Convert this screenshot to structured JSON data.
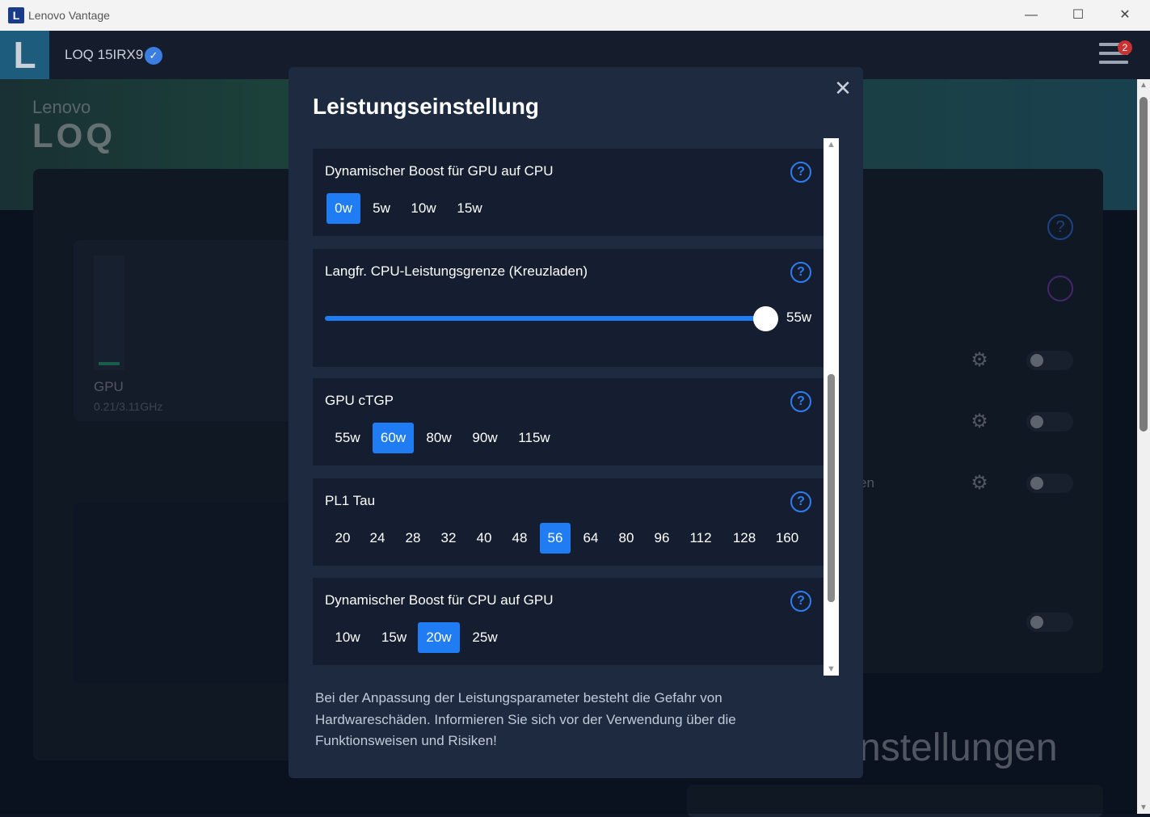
{
  "window": {
    "title": "Lenovo Vantage",
    "logo_letter": "L",
    "minimize": "—",
    "maximize": "☐",
    "close": "✕"
  },
  "header": {
    "logo_letter": "L",
    "device_name": "LOQ 15IRX9",
    "verified": "✓",
    "notification_count": "2"
  },
  "background": {
    "brand_top": "Lenovo",
    "brand_bottom": "LOQ",
    "gpu_label": "GPU",
    "gpu_clock": "0.21/3.11GHz",
    "gpu_level": 0.03,
    "partial_text": "en",
    "section_title": "nstellungen",
    "help": "?",
    "gear": "⚙"
  },
  "modal": {
    "title": "Leistungseinstellung",
    "close": "✕",
    "help": "?",
    "settings": [
      {
        "label": "Dynamischer Boost für GPU auf CPU",
        "options": [
          "0w",
          "5w",
          "10w",
          "15w"
        ],
        "selected": "0w"
      },
      {
        "label": "Langfr. CPU-Leistungsgrenze (Kreuzladen)",
        "slider_value": "55w",
        "slider_fraction": 1.0
      },
      {
        "label": "GPU cTGP",
        "options": [
          "55w",
          "60w",
          "80w",
          "90w",
          "115w"
        ],
        "selected": "60w"
      },
      {
        "label": "PL1 Tau",
        "options": [
          "20",
          "24",
          "28",
          "32",
          "40",
          "48",
          "56",
          "64",
          "80",
          "96",
          "112",
          "128",
          "160"
        ],
        "selected": "56"
      },
      {
        "label": "Dynamischer Boost für CPU auf GPU",
        "options": [
          "10w",
          "15w",
          "20w",
          "25w"
        ],
        "selected": "20w"
      }
    ],
    "warning": "Bei der Anpassung der Leistungsparameter besteht die Gefahr von Hardwareschäden. Informieren Sie sich vor der Verwendung über die Funktionsweisen und Risiken!"
  },
  "colors": {
    "accent": "#1f7cf2",
    "panel": "#151e30",
    "modal": "#1e2a40"
  }
}
